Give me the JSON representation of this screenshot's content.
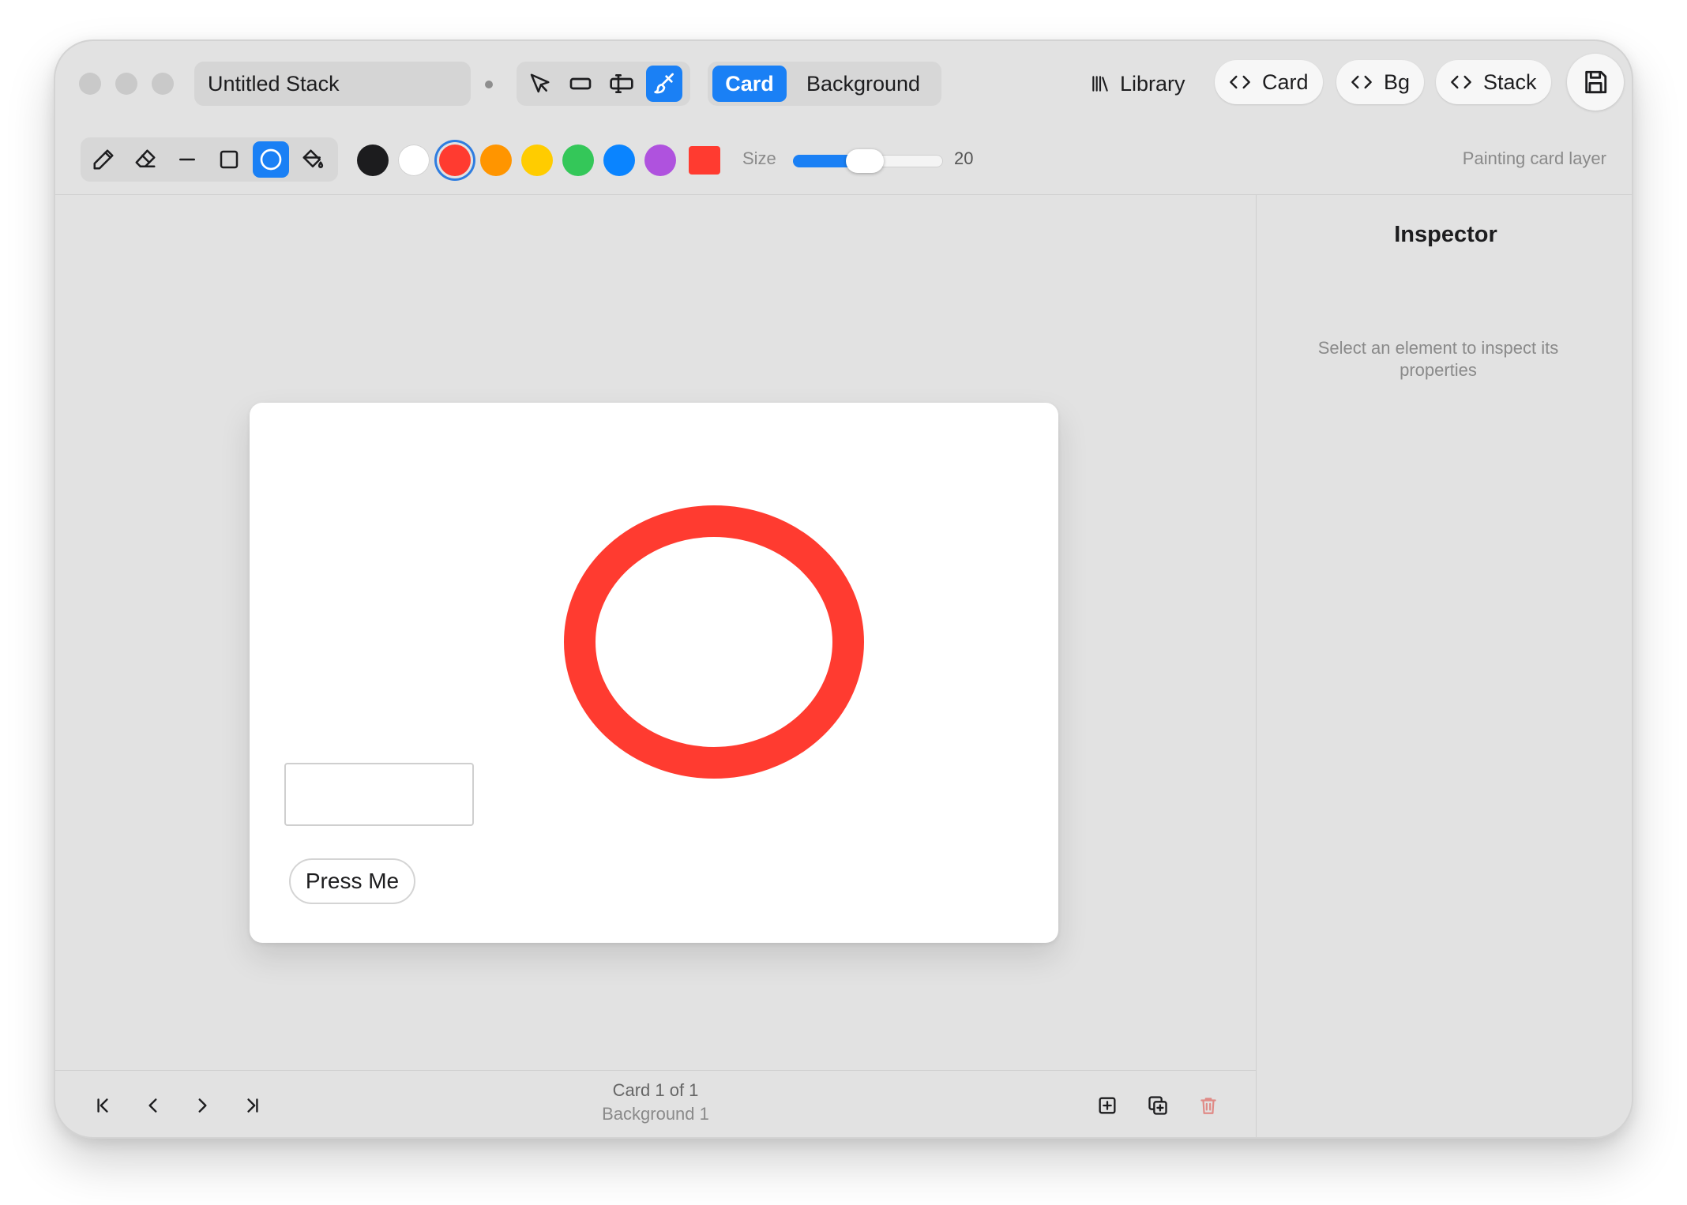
{
  "window": {
    "stack_name": "Untitled Stack"
  },
  "toolbar": {
    "layer_card": "Card",
    "layer_background": "Background",
    "library": "Library",
    "script_card": "Card",
    "script_bg": "Bg",
    "script_stack": "Stack",
    "accent_color": "#1a80f5"
  },
  "paint": {
    "swatches": [
      "#1c1c1e",
      "#ffffff",
      "#ff3b30",
      "#ff9500",
      "#ffcc00",
      "#34c759",
      "#0a84ff",
      "#af52de"
    ],
    "selected_color": "#ff3b30",
    "fill_color": "#ff3b30",
    "size_label": "Size",
    "size_value": "20",
    "size_fraction": 0.48,
    "status": "Painting card layer"
  },
  "card": {
    "button_label": "Press Me",
    "shape_color": "#ff3b30"
  },
  "inspector": {
    "title": "Inspector",
    "empty_message": "Select an element to inspect its properties"
  },
  "footer": {
    "card_position": "Card 1 of 1",
    "background_name": "Background 1"
  }
}
